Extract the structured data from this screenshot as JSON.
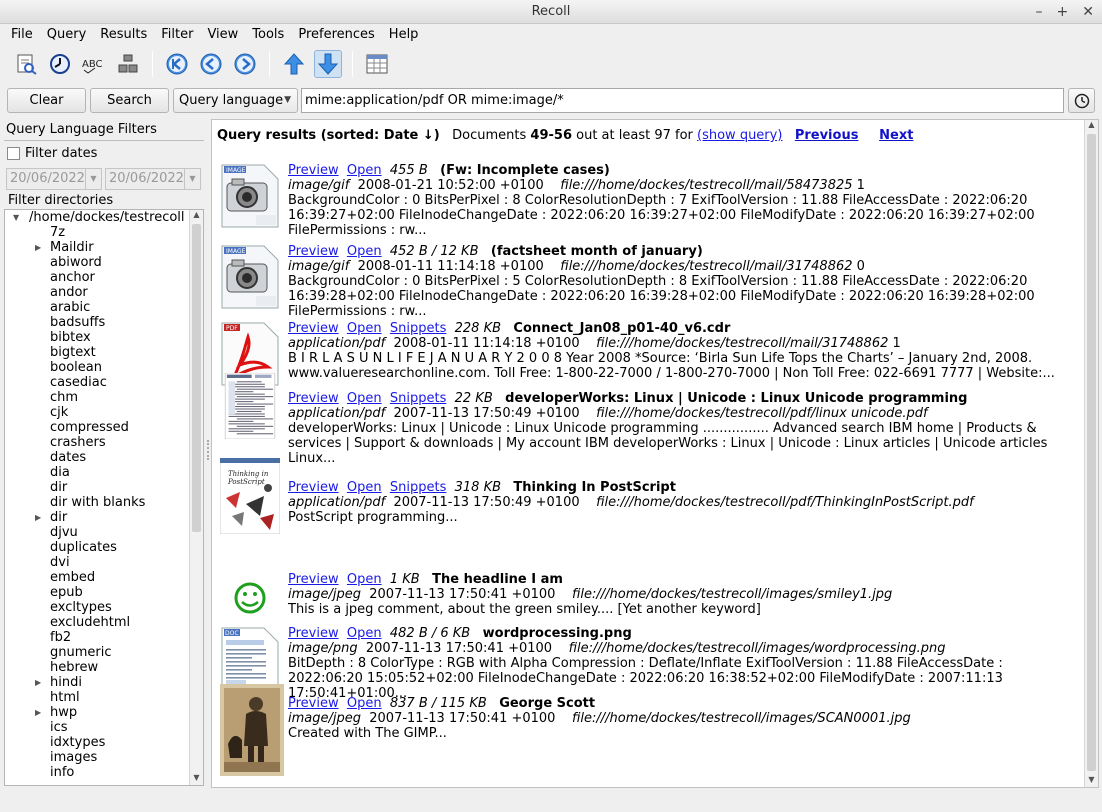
{
  "window": {
    "title": "Recoll"
  },
  "menu": [
    "File",
    "Query",
    "Results",
    "Filter",
    "View",
    "Tools",
    "Preferences",
    "Help"
  ],
  "toolbar": {
    "icons": [
      "spelling-query-icon",
      "history-clock-icon",
      "spell-abc-icon",
      "index-icon",
      "first-page-icon",
      "previous-page-icon",
      "next-page-icon",
      "sort-ascending-icon",
      "sort-descending-icon",
      "table-view-icon"
    ]
  },
  "search": {
    "clear_label": "Clear",
    "search_label": "Search",
    "mode": "Query language",
    "query": "mime:application/pdf OR mime:image/*"
  },
  "filters": {
    "title": "Query Language Filters",
    "filter_dates_label": "Filter dates",
    "date_from": "20/06/2022",
    "date_to": "20/06/2022",
    "dirs_label": "Filter directories",
    "tree": [
      {
        "label": "/home/dockes/testrecoll",
        "level": 0,
        "expander": "open"
      },
      {
        "label": "7z",
        "level": 1,
        "expander": ""
      },
      {
        "label": "Maildir",
        "level": 1,
        "expander": "closed"
      },
      {
        "label": "abiword",
        "level": 1,
        "expander": ""
      },
      {
        "label": "anchor",
        "level": 1,
        "expander": ""
      },
      {
        "label": "andor",
        "level": 1,
        "expander": ""
      },
      {
        "label": "arabic",
        "level": 1,
        "expander": ""
      },
      {
        "label": "badsuffs",
        "level": 1,
        "expander": ""
      },
      {
        "label": "bibtex",
        "level": 1,
        "expander": ""
      },
      {
        "label": "bigtext",
        "level": 1,
        "expander": ""
      },
      {
        "label": "boolean",
        "level": 1,
        "expander": ""
      },
      {
        "label": "casediac",
        "level": 1,
        "expander": ""
      },
      {
        "label": "chm",
        "level": 1,
        "expander": ""
      },
      {
        "label": "cjk",
        "level": 1,
        "expander": ""
      },
      {
        "label": "compressed",
        "level": 1,
        "expander": ""
      },
      {
        "label": "crashers",
        "level": 1,
        "expander": ""
      },
      {
        "label": "dates",
        "level": 1,
        "expander": ""
      },
      {
        "label": "dia",
        "level": 1,
        "expander": ""
      },
      {
        "label": "dir",
        "level": 1,
        "expander": ""
      },
      {
        "label": "dir with blanks",
        "level": 1,
        "expander": ""
      },
      {
        "label": "dir",
        "level": 1,
        "expander": "closed"
      },
      {
        "label": "djvu",
        "level": 1,
        "expander": ""
      },
      {
        "label": "duplicates",
        "level": 1,
        "expander": ""
      },
      {
        "label": "dvi",
        "level": 1,
        "expander": ""
      },
      {
        "label": "embed",
        "level": 1,
        "expander": ""
      },
      {
        "label": "epub",
        "level": 1,
        "expander": ""
      },
      {
        "label": "excltypes",
        "level": 1,
        "expander": ""
      },
      {
        "label": "excludehtml",
        "level": 1,
        "expander": ""
      },
      {
        "label": "fb2",
        "level": 1,
        "expander": ""
      },
      {
        "label": "gnumeric",
        "level": 1,
        "expander": ""
      },
      {
        "label": "hebrew",
        "level": 1,
        "expander": ""
      },
      {
        "label": "hindi",
        "level": 1,
        "expander": "closed"
      },
      {
        "label": "html",
        "level": 1,
        "expander": ""
      },
      {
        "label": "hwp",
        "level": 1,
        "expander": "closed"
      },
      {
        "label": "ics",
        "level": 1,
        "expander": ""
      },
      {
        "label": "idxtypes",
        "level": 1,
        "expander": ""
      },
      {
        "label": "images",
        "level": 1,
        "expander": ""
      },
      {
        "label": "info",
        "level": 1,
        "expander": ""
      }
    ]
  },
  "results": {
    "header_prefix": "Query results (sorted: Date ↓)",
    "docs_label": "Documents",
    "range": "49-56",
    "out_of": "out at least 97 for",
    "show_query": "(show query)",
    "previous": "Previous",
    "next": "Next",
    "items": [
      {
        "thumb": "image",
        "links": [
          "Preview",
          "Open"
        ],
        "size": "455 B",
        "title": "(Fw: Incomplete cases)",
        "mime": "image/gif",
        "date": "2008-01-21 10:52:00 +0100",
        "url": "file:///home/dockes/testrecoll/mail/58473825",
        "url_suffix": "1",
        "abstract": "BackgroundColor : 0 BitsPerPixel : 8 ColorResolutionDepth : 7 ExifToolVersion : 11.88 FileAccessDate : 2022:06:20 16:39:27+02:00 FileInodeChangeDate : 2022:06:20 16:39:27+02:00 FileModifyDate : 2022:06:20 16:39:27+02:00 FilePermissions : rw..."
      },
      {
        "thumb": "image",
        "links": [
          "Preview",
          "Open"
        ],
        "size": "452 B / 12 KB",
        "title": "(factsheet month of january)",
        "mime": "image/gif",
        "date": "2008-01-11 11:14:18 +0100",
        "url": "file:///home/dockes/testrecoll/mail/31748862",
        "url_suffix": "0",
        "abstract": "BackgroundColor : 0 BitsPerPixel : 5 ColorResolutionDepth : 8 ExifToolVersion : 11.88 FileAccessDate : 2022:06:20 16:39:28+02:00 FileInodeChangeDate : 2022:06:20 16:39:28+02:00 FileModifyDate : 2022:06:20 16:39:28+02:00 FilePermissions : rw..."
      },
      {
        "thumb": "pdf",
        "links": [
          "Preview",
          "Open",
          "Snippets"
        ],
        "size": "228 KB",
        "title": "Connect_Jan08_p01-40_v6.cdr",
        "mime": "application/pdf",
        "date": "2008-01-11 11:14:18 +0100",
        "url": "file:///home/dockes/testrecoll/mail/31748862",
        "url_suffix": "1",
        "abstract": "B I R L A S U N L I F E J A N U A R Y 2 0 0 8 Year 2008 *Source: ‘Birla Sun Life Tops the Charts’ – January 2nd, 2008. www.valueresearchonline.com. Toll Free: 1-800-22-7000 / 1-800-270-7000 | Non Toll Free: 022-6691 7777 | Website:..."
      },
      {
        "thumb": "page",
        "links": [
          "Preview",
          "Open",
          "Snippets"
        ],
        "size": "22 KB",
        "title": "developerWorks: Linux | Unicode : Linux Unicode programming",
        "mime": "application/pdf",
        "date": "2007-11-13 17:50:49 +0100",
        "url": "file:///home/dockes/testrecoll/pdf/linux unicode.pdf",
        "url_suffix": "",
        "abstract": "developerWorks: Linux | Unicode : Linux Unicode programming ................ Advanced search IBM home | Products & services | Support & downloads | My account IBM developerWorks : Linux | Unicode : Linux articles | Unicode articles Linux..."
      },
      {
        "thumb": "book",
        "links": [
          "Preview",
          "Open",
          "Snippets"
        ],
        "size": "318 KB",
        "title": "Thinking In PostScript",
        "mime": "application/pdf",
        "date": "2007-11-13 17:50:49 +0100",
        "url": "file:///home/dockes/testrecoll/pdf/ThinkingInPostScript.pdf",
        "url_suffix": "",
        "abstract": "PostScript programming..."
      },
      {
        "thumb": "smiley",
        "links": [
          "Preview",
          "Open"
        ],
        "size": "1 KB",
        "title": "The headline I am",
        "mime": "image/jpeg",
        "date": "2007-11-13 17:50:41 +0100",
        "url": "file:///home/dockes/testrecoll/images/smiley1.jpg",
        "url_suffix": "",
        "abstract": "This is a jpeg comment, about the green smiley.... [Yet another keyword]"
      },
      {
        "thumb": "doc",
        "links": [
          "Preview",
          "Open"
        ],
        "size": "482 B / 6 KB",
        "title": "wordprocessing.png",
        "mime": "image/png",
        "date": "2007-11-13 17:50:41 +0100",
        "url": "file:///home/dockes/testrecoll/images/wordprocessing.png",
        "url_suffix": "",
        "abstract": "BitDepth : 8 ColorType : RGB with Alpha Compression : Deflate/Inflate ExifToolVersion : 11.88 FileAccessDate : 2022:06:20 15:05:52+02:00 FileInodeChangeDate : 2022:06:20 16:38:52+02:00 FileModifyDate : 2007:11:13 17:50:41+01:00..."
      },
      {
        "thumb": "photo",
        "links": [
          "Preview",
          "Open"
        ],
        "size": "837 B / 115 KB",
        "title": "George Scott",
        "mime": "image/jpeg",
        "date": "2007-11-13 17:50:41 +0100",
        "url": "file:///home/dockes/testrecoll/images/SCAN0001.jpg",
        "url_suffix": "",
        "abstract": "Created with The GIMP..."
      }
    ]
  }
}
